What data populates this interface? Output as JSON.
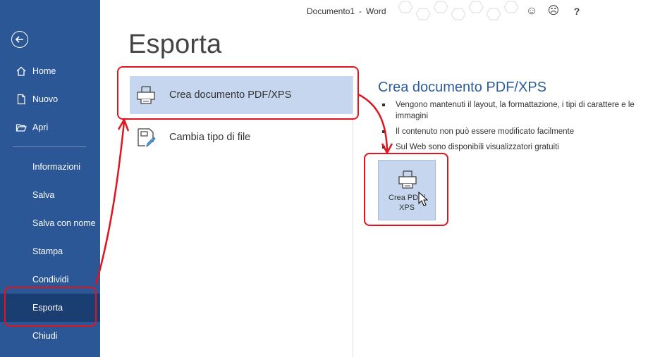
{
  "window": {
    "doc_name": "Documento1",
    "separator": "-",
    "app_name": "Word"
  },
  "sidebar": {
    "items": [
      {
        "label": "Home",
        "icon": "home-icon"
      },
      {
        "label": "Nuovo",
        "icon": "new-document-icon"
      },
      {
        "label": "Apri",
        "icon": "open-folder-icon"
      },
      {
        "label": "Informazioni"
      },
      {
        "label": "Salva"
      },
      {
        "label": "Salva con nome"
      },
      {
        "label": "Stampa"
      },
      {
        "label": "Condividi"
      },
      {
        "label": "Esporta",
        "selected": true
      },
      {
        "label": "Chiudi"
      }
    ]
  },
  "main": {
    "title": "Esporta",
    "options": [
      {
        "label": "Crea documento PDF/XPS",
        "icon": "pdf-printer-icon",
        "selected": true
      },
      {
        "label": "Cambia tipo di file",
        "icon": "change-file-type-icon"
      }
    ]
  },
  "detail": {
    "title": "Crea documento PDF/XPS",
    "bullets": [
      "Vengono mantenuti il layout, la formattazione, i tipi di carattere e le immagini",
      "Il contenuto non può essere modificato facilmente",
      "Sul Web sono disponibili visualizzatori gratuiti"
    ],
    "button_line1": "Crea PDF/",
    "button_line2": "XPS"
  },
  "colors": {
    "sidebar": "#2b5797",
    "sidebar_selected": "#1a3e72",
    "option_selected": "#c5d6ee",
    "annotation": "#e0141e"
  }
}
